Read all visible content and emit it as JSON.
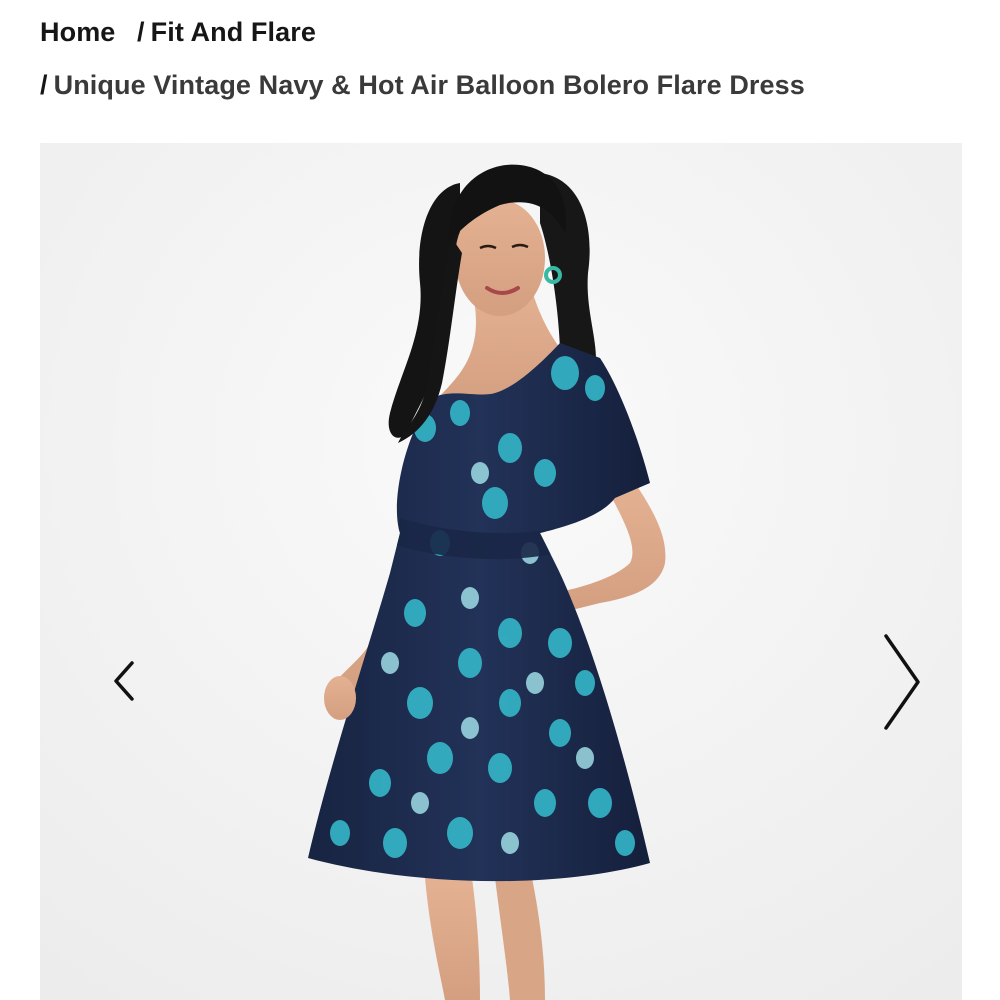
{
  "breadcrumb": {
    "home": "Home",
    "category": "Fit And Flare",
    "current": "Unique Vintage Navy & Hot Air Balloon Bolero Flare Dress",
    "separator": "/"
  },
  "gallery": {
    "prev_icon": "chevron-left-icon",
    "next_icon": "chevron-right-icon"
  },
  "colors": {
    "background": "#ffffff",
    "gallery_bg": "#f3f3f3",
    "dress_navy": "#1c2a4c",
    "balloon_teal": "#33b3c4",
    "text": "#161616"
  }
}
